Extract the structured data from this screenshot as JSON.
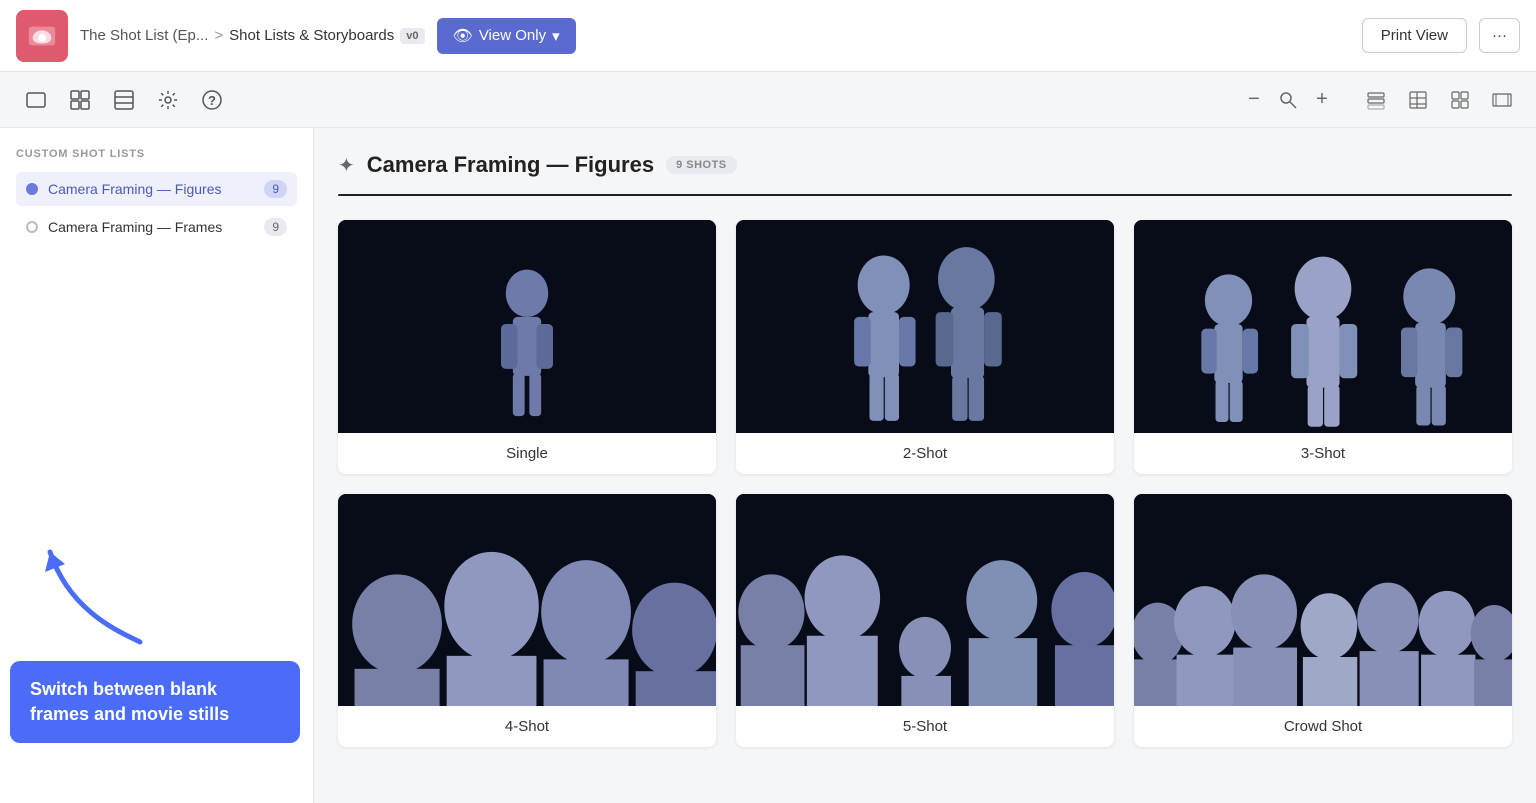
{
  "topBar": {
    "appTitle": "The Shot List (Ep...",
    "separator": ">",
    "section": "Shot Lists & Storyboards",
    "versionBadge": "v0",
    "viewOnly": "View Only",
    "printView": "Print View",
    "moreLabel": "···"
  },
  "toolbar": {
    "buttons": [
      {
        "name": "frame-icon",
        "icon": "⬜"
      },
      {
        "name": "grid-icon",
        "icon": "⊞"
      },
      {
        "name": "panel-icon",
        "icon": "▤"
      },
      {
        "name": "settings-icon",
        "icon": "⚙"
      },
      {
        "name": "help-icon",
        "icon": "?"
      }
    ]
  },
  "sidebar": {
    "sectionTitle": "CUSTOM SHOT LISTS",
    "items": [
      {
        "label": "Camera Framing — Figures",
        "count": "9",
        "active": true
      },
      {
        "label": "Camera Framing — Frames",
        "count": "9",
        "active": false
      }
    ],
    "tooltip": "Switch between blank frames and movie stills"
  },
  "content": {
    "title": "Camera Framing — Figures",
    "shotsBadge": "9 SHOTS",
    "shots": [
      {
        "label": "Single"
      },
      {
        "label": "2-Shot"
      },
      {
        "label": "3-Shot"
      },
      {
        "label": "4-Shot"
      },
      {
        "label": "5-Shot"
      },
      {
        "label": "Crowd Shot"
      }
    ]
  }
}
